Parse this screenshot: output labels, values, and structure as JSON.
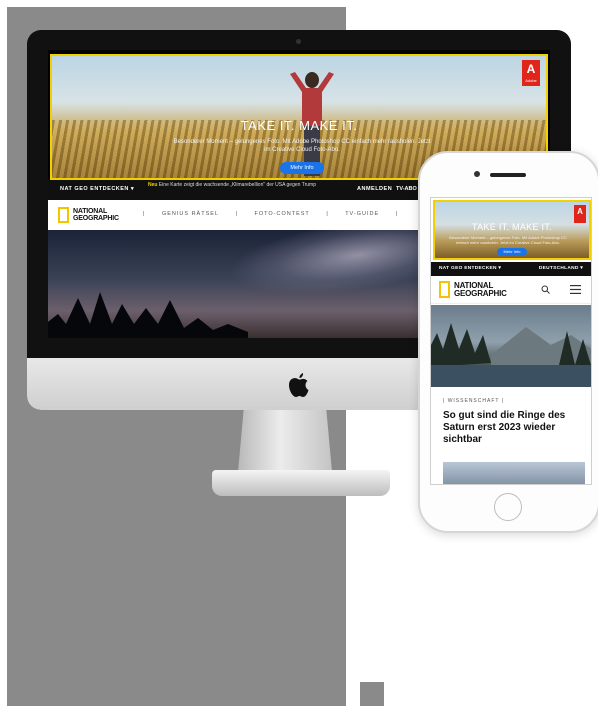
{
  "desktop": {
    "ad": {
      "headline": "TAKE IT. MAKE IT.",
      "text": "Besonderer Moment – gelungenes Foto. Mit Adobe Photoshop CC einfach mehr rausholen. Jetzt im Creative Cloud Foto-Abo.",
      "cta": "Mehr Info",
      "brand_mark": "A",
      "brand_name": "Adobe"
    },
    "topbar": {
      "nav": "NAT GEO ENTDECKEN ▾",
      "news_label": "Neu",
      "news_text": "Eine Karte zeigt die wachsende „Klimarebellion\" der USA gegen Trump",
      "login": "ANMELDEN",
      "tv": "TV-ABO"
    },
    "logo": {
      "line1": "NATIONAL",
      "line2": "GEOGRAPHIC"
    },
    "menu": [
      "GENIUS RÄTSEL",
      "FOTO-CONTEST",
      "TV-GUIDE"
    ]
  },
  "mobile": {
    "ad": {
      "headline": "TAKE IT. MAKE IT.",
      "text": "Besonderer Moment – gelungenes Foto. Mit Adobe Photoshop CC einfach mehr rausholen. Jetzt im Creative Cloud Foto-Abo.",
      "cta": "Mehr Info",
      "brand_mark": "A"
    },
    "topbar": {
      "nav": "NAT GEO ENTDECKEN ▾",
      "region": "DEUTSCHLAND ▾"
    },
    "logo": {
      "line1": "NATIONAL",
      "line2": "GEOGRAPHIC"
    },
    "article": {
      "category": "WISSENSCHAFT",
      "headline": "So gut sind die Ringe des Saturn erst 2023 wieder sichtbar"
    }
  },
  "colors": {
    "accent_yellow": "#f5c400",
    "adobe_red": "#e0251b",
    "cta_blue": "#1a73e8",
    "panel_gray": "#8a8a8a"
  }
}
